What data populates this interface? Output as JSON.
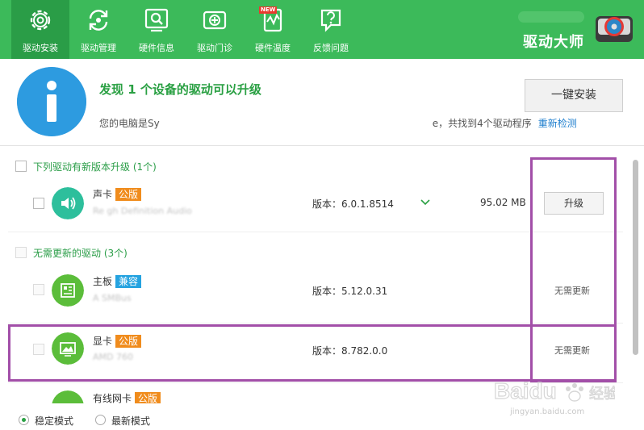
{
  "nav": {
    "items": [
      {
        "label": "驱动安装",
        "icon": "gear-icon",
        "active": true
      },
      {
        "label": "驱动管理",
        "icon": "refresh-icon",
        "active": false
      },
      {
        "label": "硬件信息",
        "icon": "magnifier-icon",
        "active": false
      },
      {
        "label": "驱动门诊",
        "icon": "clinic-icon",
        "active": false
      },
      {
        "label": "硬件温度",
        "icon": "thermometer-icon",
        "active": false
      },
      {
        "label": "反馈问题",
        "icon": "question-icon",
        "active": false
      }
    ],
    "new_badge": "NEW"
  },
  "brand": {
    "title": "驱动大师"
  },
  "summary": {
    "title": "发现 1 个设备的驱动可以升级",
    "desc_prefix": "您的电脑是Sy",
    "desc_suffix": "e，共找到4个驱动程序",
    "rescan": "重新检测",
    "install_all": "一键安装"
  },
  "groups": {
    "upgrade": {
      "title": "下列驱动有新版本升级 (1个)"
    },
    "no_update": {
      "title": "无需更新的驱动 (3个)"
    }
  },
  "devices": [
    {
      "name": "声卡",
      "tag": "公版",
      "tag_color": "#f08c1d",
      "sub": "Re            gh Definition Audio",
      "version": "版本：6.0.1.8514",
      "size": "95.02 MB",
      "action": "升级",
      "icon": "speaker-icon",
      "icon_color": "#2dbf9c"
    },
    {
      "name": "主板",
      "tag": "兼容",
      "tag_color": "#25a3e0",
      "sub": "A          SMBus",
      "version": "版本：5.12.0.31",
      "status": "无需更新",
      "icon": "motherboard-icon",
      "icon_color": "#5bbd3a"
    },
    {
      "name": "显卡",
      "tag": "公版",
      "tag_color": "#f08c1d",
      "sub": "AMD 760",
      "version": "版本：8.782.0.0",
      "status": "无需更新",
      "icon": "display-icon",
      "icon_color": "#5bbd3a"
    },
    {
      "name": "有线网卡",
      "tag": "公版",
      "tag_color": "#f08c1d",
      "icon": "network-icon",
      "icon_color": "#5bbd3a"
    }
  ],
  "modes": {
    "stable": "稳定模式",
    "latest": "最新模式",
    "selected": "stable"
  },
  "watermark": {
    "text": "jingyan.baidu.com"
  }
}
